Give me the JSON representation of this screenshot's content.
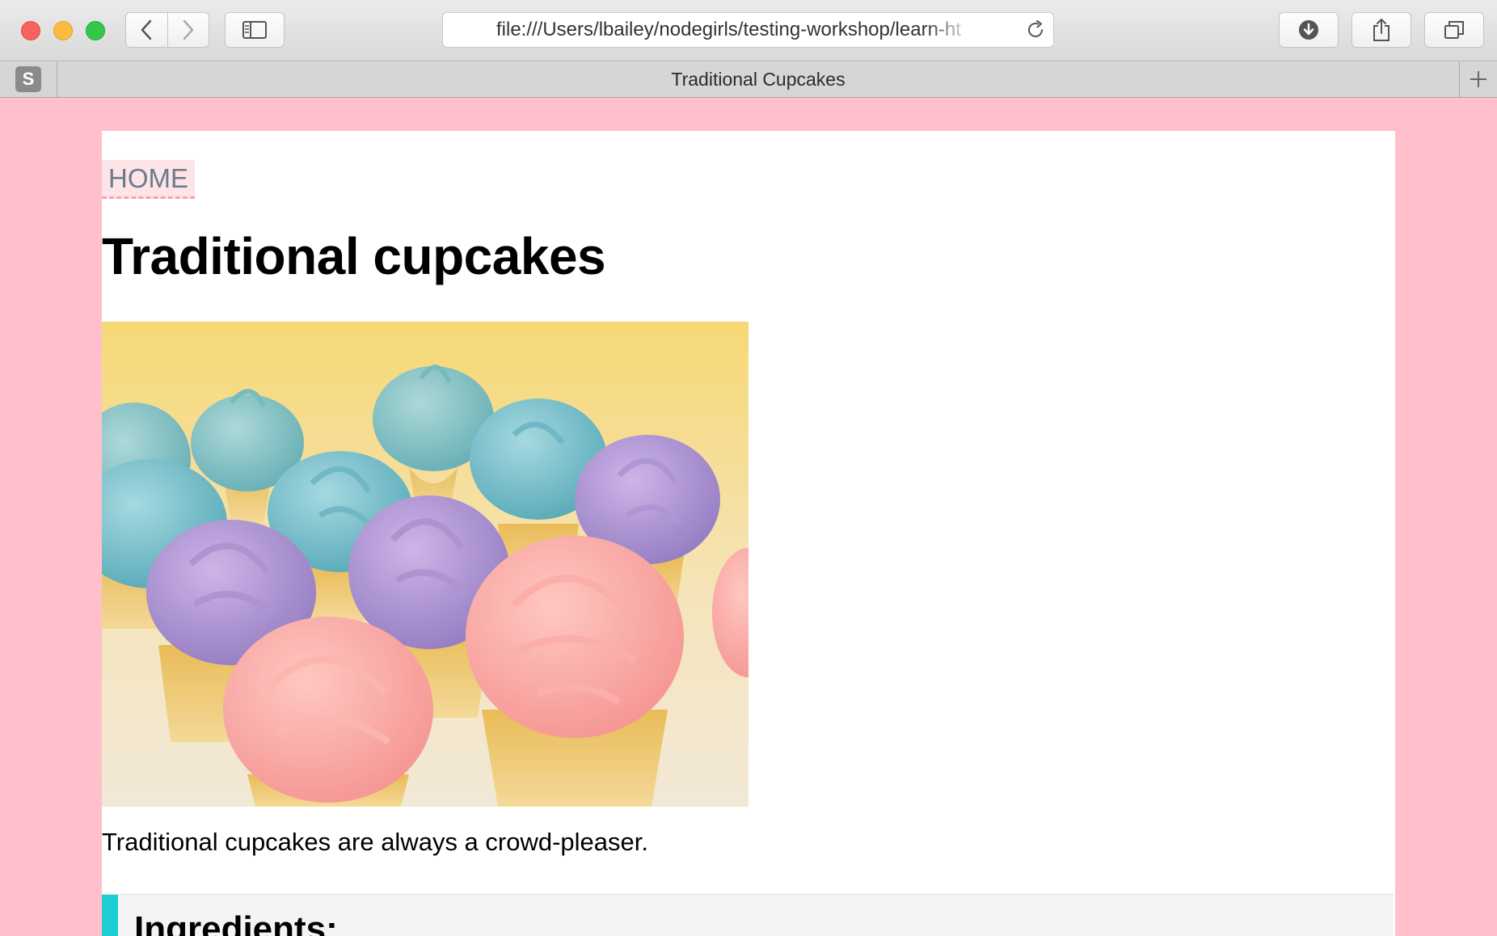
{
  "browser": {
    "url": "file:///Users/lbailey/nodegirls/testing-workshop/learn-ht",
    "tab_title": "Traditional Cupcakes",
    "pinned_tab_letter": "S"
  },
  "page": {
    "nav_home": "HOME",
    "title": "Traditional cupcakes",
    "hero_image_alt": "Pastel cupcakes with blue, purple and pink frosting",
    "description": "Traditional cupcakes are always a crowd-pleaser.",
    "ingredients_heading": "Ingredients:"
  },
  "colors": {
    "page_background": "#ffc0cb",
    "card_background": "#ffffff",
    "home_link_bg": "#fde4e6",
    "ingredients_accent": "#1ccdd3"
  }
}
